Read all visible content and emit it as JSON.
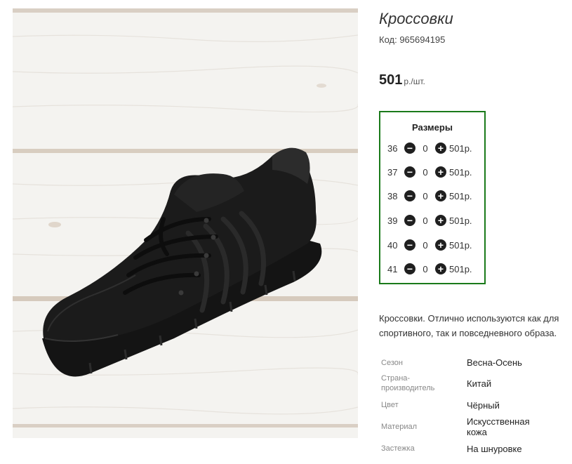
{
  "product": {
    "title": "Кроссовки",
    "code": "Код: 965694195",
    "price_value": "501",
    "price_unit": "р./шт."
  },
  "sizes": {
    "title": "Размеры",
    "items": [
      {
        "size": "36",
        "qty": "0",
        "price": "501р."
      },
      {
        "size": "37",
        "qty": "0",
        "price": "501р."
      },
      {
        "size": "38",
        "qty": "0",
        "price": "501р."
      },
      {
        "size": "39",
        "qty": "0",
        "price": "501р."
      },
      {
        "size": "40",
        "qty": "0",
        "price": "501р."
      },
      {
        "size": "41",
        "qty": "0",
        "price": "501р."
      }
    ]
  },
  "description": {
    "line1": "Кроссовки. Отлично используются как для",
    "line2": "спортивного, так и повседневного образа."
  },
  "properties": [
    {
      "label": "Сезон",
      "value": "Весна-Осень"
    },
    {
      "label": "Страна-\nпроизводитель",
      "value": "Китай"
    },
    {
      "label": "Цвет",
      "value": "Чёрный"
    },
    {
      "label": "Материал",
      "value": "Искусственная\nкожа"
    },
    {
      "label": "Застежка",
      "value": "На шнуровке"
    }
  ],
  "icons": {
    "minus": "minus-circle-icon",
    "plus": "plus-circle-icon"
  },
  "colors": {
    "sizes_border": "#1a7a1a",
    "button": "#1f1f1f"
  }
}
